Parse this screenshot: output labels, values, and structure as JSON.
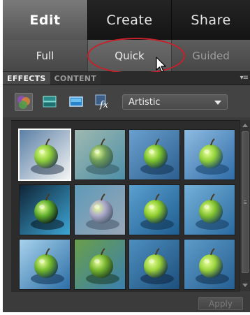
{
  "top_tabs": [
    {
      "label": "Edit",
      "active": true
    },
    {
      "label": "Create",
      "active": false
    },
    {
      "label": "Share",
      "active": false
    }
  ],
  "sub_tabs": [
    {
      "label": "Full",
      "state": "normal"
    },
    {
      "label": "Quick",
      "state": "active"
    },
    {
      "label": "Guided",
      "state": "dimmed"
    }
  ],
  "panel_tabs": [
    {
      "label": "EFFECTS",
      "active": true
    },
    {
      "label": "CONTENT",
      "active": false
    }
  ],
  "toolbar": {
    "tools": [
      {
        "icon": "filters-icon",
        "active": true
      },
      {
        "icon": "layer-styles-icon",
        "active": false
      },
      {
        "icon": "photo-effects-icon",
        "active": false
      },
      {
        "icon": "fx-effects-icon",
        "active": false
      }
    ],
    "dropdown_value": "Artistic"
  },
  "thumbnails": {
    "selected_index": 0,
    "count": 12,
    "items": [
      {
        "style": "sketch"
      },
      {
        "style": "cutout"
      },
      {
        "style": "dry-brush"
      },
      {
        "style": "film-grain"
      },
      {
        "style": "fresco"
      },
      {
        "style": "neon-glow"
      },
      {
        "style": "paint-daubs"
      },
      {
        "style": "palette-knife"
      },
      {
        "style": "plastic-wrap"
      },
      {
        "style": "poster-edges"
      },
      {
        "style": "rough-pastels"
      },
      {
        "style": "smudge-stick"
      }
    ]
  },
  "footer": {
    "apply_label": "Apply",
    "apply_enabled": false
  },
  "colors": {
    "annotation_ellipse": "#c8202a",
    "panel_bg": "#3b3b3b",
    "active_tab": "#6b6b6b"
  }
}
